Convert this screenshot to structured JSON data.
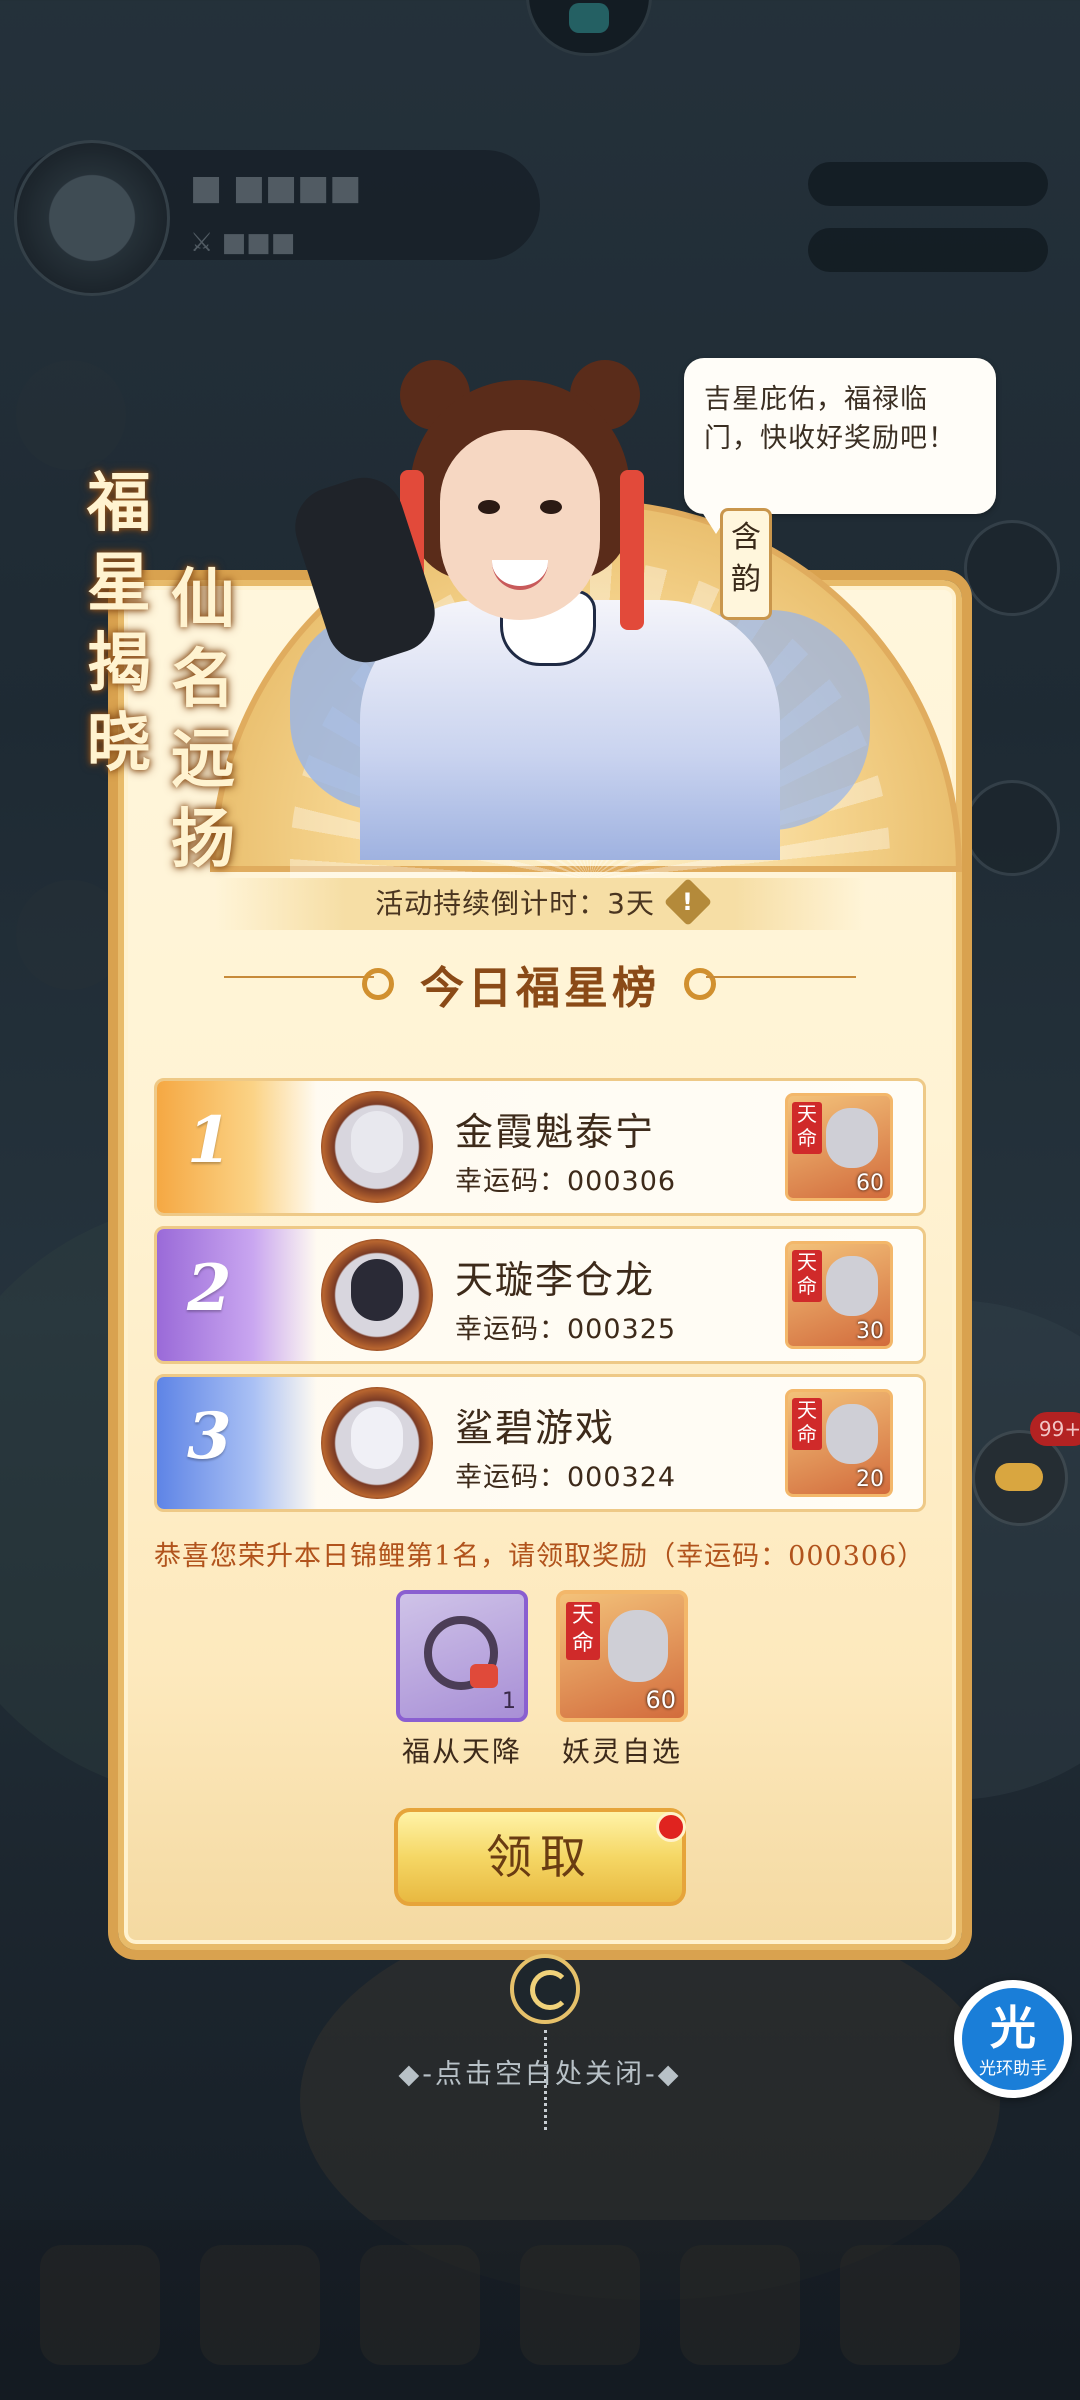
{
  "speech": {
    "text": "吉星庇佑，福禄临门，快收好奖励吧！"
  },
  "host_name": "含韵",
  "title_columns": [
    "仙名远扬",
    "福星揭晓"
  ],
  "countdown": {
    "text": "活动持续倒计时：3天",
    "icon": "!"
  },
  "rank_title": "今日福星榜",
  "leaderboard": [
    {
      "rank": "1",
      "name": "金霞魁泰宁",
      "code": "幸运码：000306",
      "reward_tag": "天命",
      "reward_count": "60",
      "color": "#f7b34d"
    },
    {
      "rank": "2",
      "name": "天璇李仓龙",
      "code": "幸运码：000325",
      "reward_tag": "天命",
      "reward_count": "30",
      "color": "#a87be0"
    },
    {
      "rank": "3",
      "name": "鲨碧游戏",
      "code": "幸运码：000324",
      "reward_tag": "天命",
      "reward_count": "20",
      "color": "#6f8fe8"
    }
  ],
  "congrats": "恭喜您荣升本日锦鲤第1名，请领取奖励（幸运码：000306）",
  "rewards": [
    {
      "label": "福从天降",
      "count": "1",
      "icon": "bracelet-icon"
    },
    {
      "label": "妖灵自选",
      "count": "60",
      "tag": "天命",
      "icon": "character-card-icon"
    }
  ],
  "claim_button": "领取",
  "close_hint": "◆-点击空白处关闭-◆",
  "assistant": {
    "glyph": "光",
    "label": "光环助手"
  },
  "chat_badge": "99+",
  "colors": {
    "accent": "#b1531c",
    "gold": "#e8bb6a"
  }
}
